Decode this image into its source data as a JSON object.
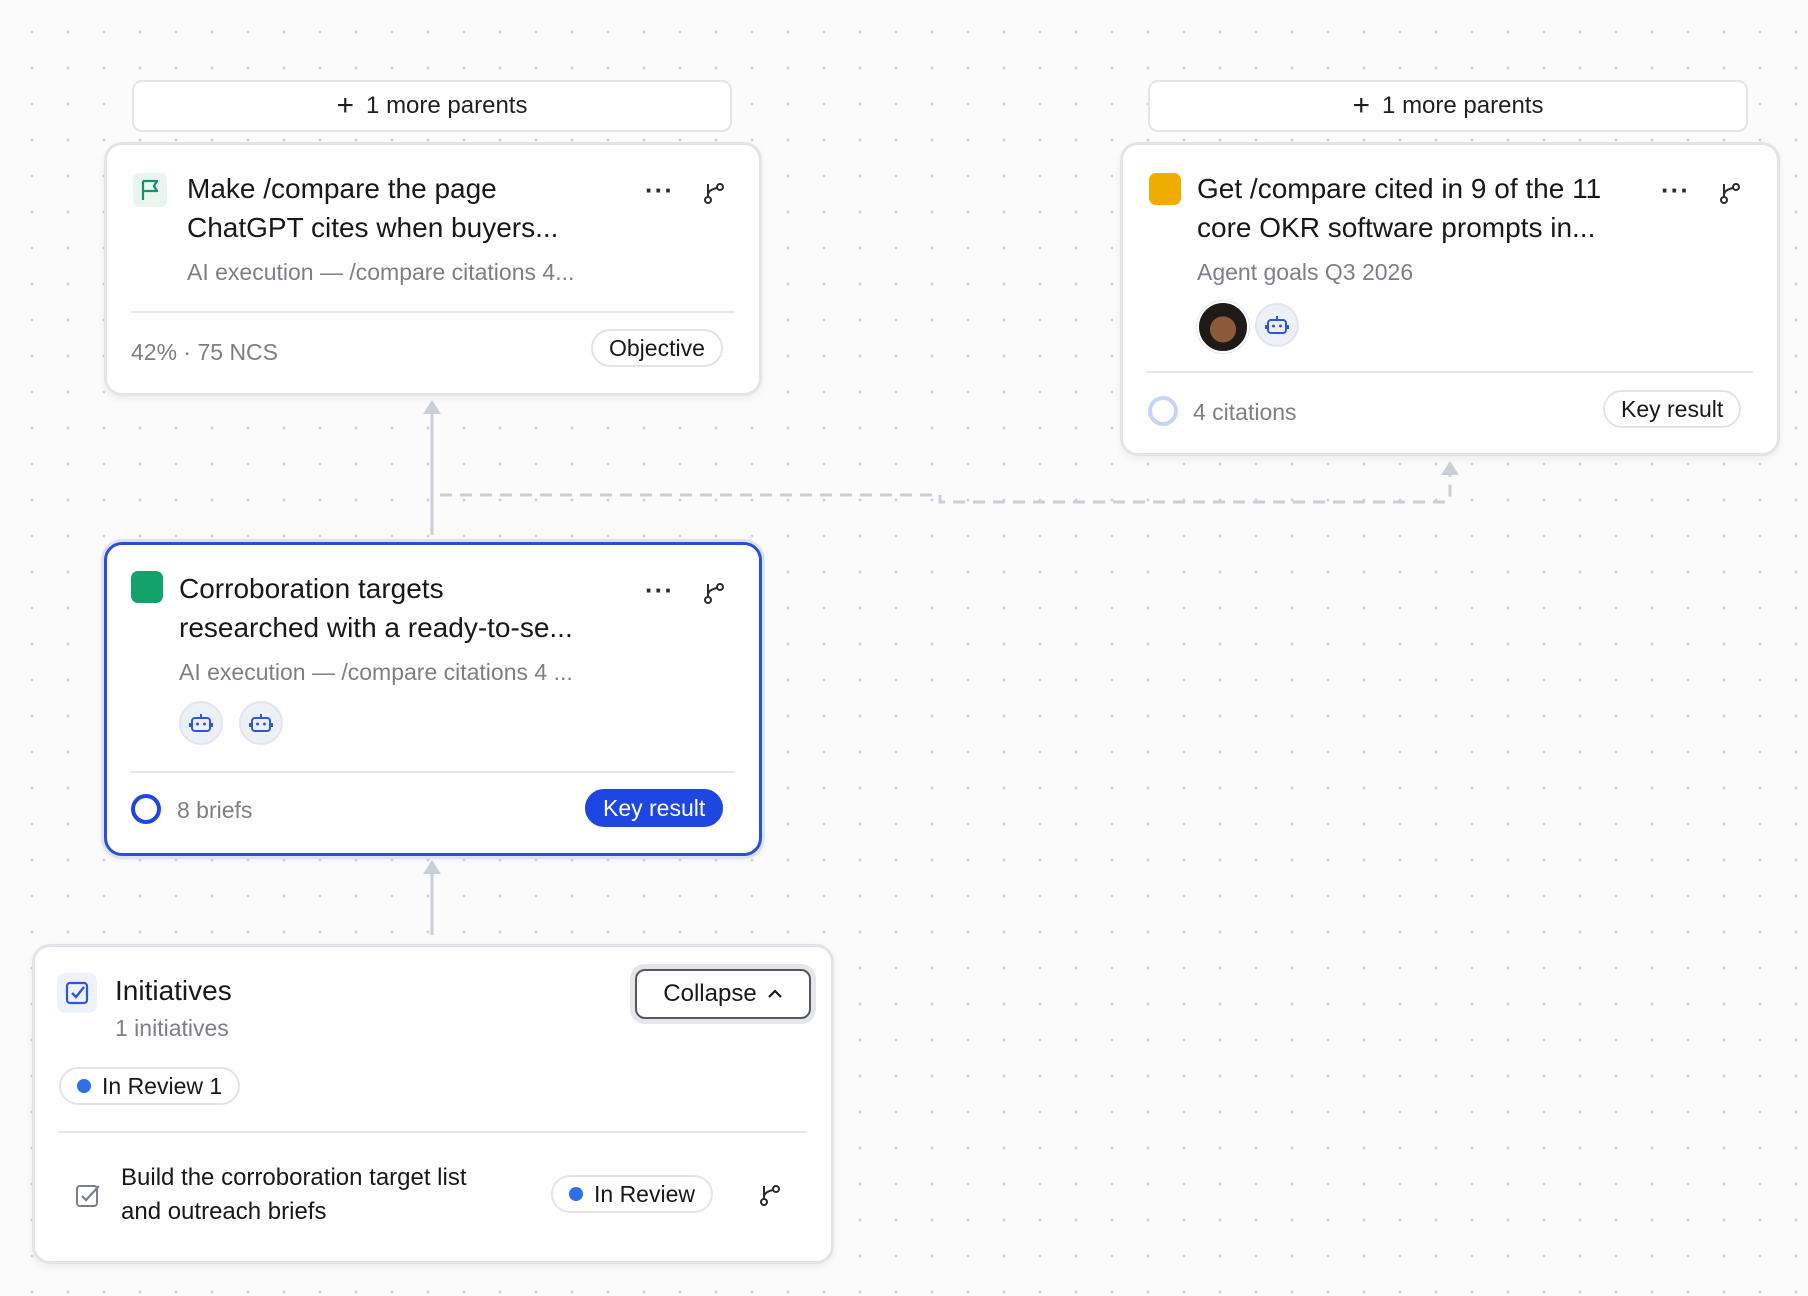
{
  "left_parents": {
    "label": "1 more parents"
  },
  "right_parents": {
    "label": "1 more parents"
  },
  "objective_card": {
    "title_line1": "Make /compare the page",
    "title_line2": "ChatGPT cites when buyers...",
    "subtitle": "AI execution — /compare citations 4...",
    "metric": "42% · 75 NCS",
    "type_label": "Objective",
    "icon": "flag-icon"
  },
  "key_result_card_right": {
    "title_line1": "Get /compare cited in 9 of the 11",
    "title_line2": "core OKR software prompts in...",
    "subtitle": "Agent goals Q3 2026",
    "metric": "4 citations",
    "type_label": "Key result",
    "status_color": "#f0ad00"
  },
  "key_result_card_selected": {
    "title_line1": "Corroboration targets",
    "title_line2": "researched with a ready-to-se...",
    "subtitle": "AI execution — /compare citations 4 ...",
    "metric": "8 briefs",
    "type_label": "Key result",
    "status_color": "#12a26b"
  },
  "initiatives_panel": {
    "title": "Initiatives",
    "count_label": "1 initiatives",
    "collapse_label": "Collapse",
    "filter_label": "In Review 1",
    "items": [
      {
        "title_line1": "Build the corroboration target list",
        "title_line2": "and outreach briefs",
        "status": "In Review"
      }
    ]
  },
  "colors": {
    "accent": "#1d47e0",
    "selected_border": "#2d4fd6",
    "status_blue": "#2f6fec"
  }
}
